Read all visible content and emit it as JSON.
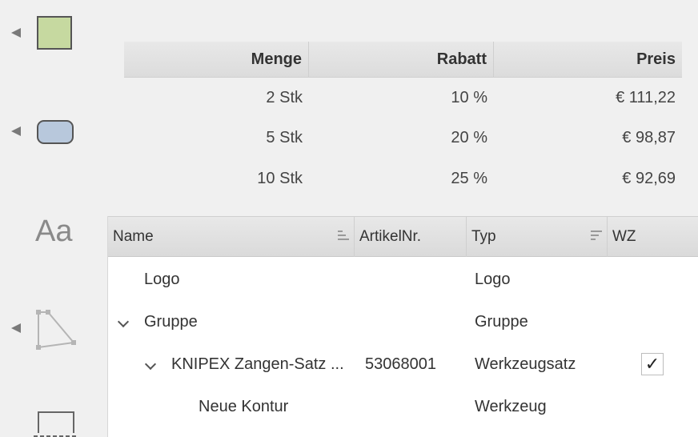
{
  "toolbar": {
    "tools": [
      {
        "name": "rectangle-tool",
        "icon": "green-rectangle-icon"
      },
      {
        "name": "rounded-rectangle-tool",
        "icon": "blue-rounded-rectangle-icon"
      },
      {
        "name": "text-tool",
        "icon": "text-icon",
        "label": "Aa"
      },
      {
        "name": "polygon-tool",
        "icon": "polygon-icon"
      },
      {
        "name": "frame-tool",
        "icon": "dashed-frame-icon"
      }
    ]
  },
  "price_table": {
    "headers": [
      "Menge",
      "Rabatt",
      "Preis"
    ],
    "rows": [
      {
        "menge": "2 Stk",
        "rabatt": "10 %",
        "preis": "€ 111,22"
      },
      {
        "menge": "5 Stk",
        "rabatt": "20 %",
        "preis": "€ 98,87"
      },
      {
        "menge": "10 Stk",
        "rabatt": "25 %",
        "preis": "€ 92,69"
      }
    ]
  },
  "tree": {
    "headers": [
      "Name",
      "ArtikelNr.",
      "Typ",
      "WZ"
    ],
    "rows": [
      {
        "name": "Logo",
        "artikel": "",
        "typ": "Logo",
        "wz": ""
      },
      {
        "name": "Gruppe",
        "artikel": "",
        "typ": "Gruppe",
        "wz": ""
      },
      {
        "name": "KNIPEX Zangen-Satz ...",
        "artikel": "53068001",
        "typ": "Werkzeugsatz",
        "wz": "✓"
      },
      {
        "name": "Neue Kontur",
        "artikel": "",
        "typ": "Werkzeug",
        "wz": ""
      }
    ]
  }
}
